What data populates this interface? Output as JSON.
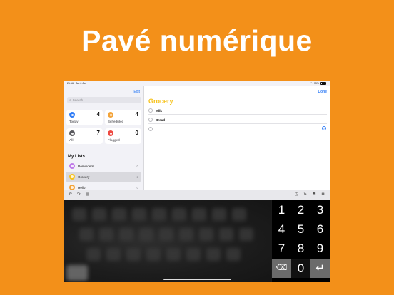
{
  "headline": "Pavé numérique",
  "status": {
    "time": "21:16",
    "date": "Sat 6 Jun",
    "battery": "93%"
  },
  "sidebar": {
    "edit_label": "Edit",
    "search_placeholder": "Search",
    "tiles": [
      {
        "label": "Today",
        "count": "4",
        "color": "#2f7cf6"
      },
      {
        "label": "Scheduled",
        "count": "4",
        "color": "#f3a43a"
      },
      {
        "label": "All",
        "count": "7",
        "color": "#5a5a5f"
      },
      {
        "label": "Flagged",
        "count": "0",
        "color": "#ee4a42"
      }
    ],
    "my_lists_title": "My Lists",
    "lists": [
      {
        "name": "Reminders",
        "count": "0",
        "color": "#c07ce8"
      },
      {
        "name": "Grocery",
        "count": "2",
        "color": "#f6c21b"
      },
      {
        "name": "Hello",
        "count": "0",
        "color": "#f3a43a"
      }
    ]
  },
  "detail": {
    "done_label": "Done",
    "list_title": "Grocery",
    "items": [
      "Milk",
      "Bread"
    ]
  },
  "toolbar": {
    "icons": [
      "undo-icon",
      "redo-icon",
      "paste-icon",
      "clock-icon",
      "location-icon",
      "flag-icon",
      "camera-icon"
    ]
  },
  "numpad": {
    "keys": [
      "1",
      "2",
      "3",
      "4",
      "5",
      "6",
      "7",
      "8",
      "9",
      "0"
    ],
    "delete_icon": "delete-icon",
    "return_icon": "return-icon"
  }
}
